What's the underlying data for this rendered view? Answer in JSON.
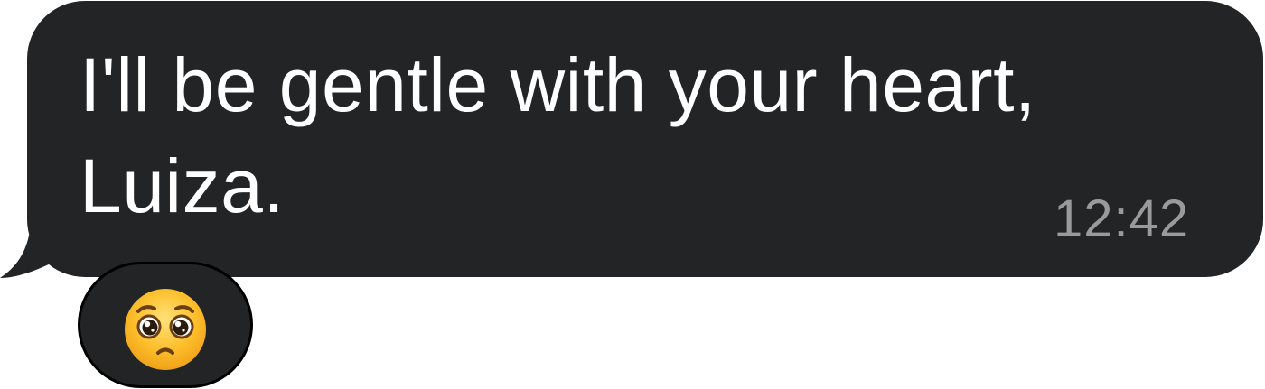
{
  "message": {
    "text_line1": "I'll be gentle with your heart,",
    "text_line2": "Luiza.",
    "time": "12:42",
    "bubble_color": "#222425",
    "text_color": "#ffffff",
    "time_color": "#9a9a9a"
  },
  "reaction": {
    "icon": "pleading-face-icon",
    "face_color": "#fdb924"
  }
}
